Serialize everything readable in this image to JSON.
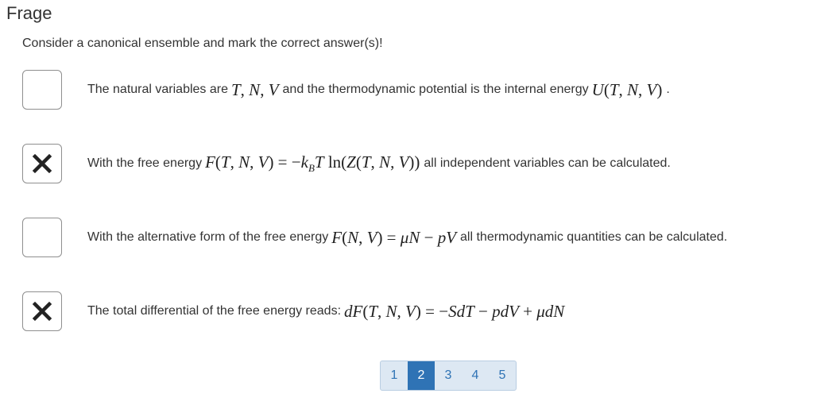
{
  "title": "Frage",
  "prompt": "Consider a canonical ensemble and mark the correct answer(s)!",
  "options": [
    {
      "checked": false,
      "text_before": "The natural variables are",
      "math_1": "T, N, V",
      "text_middle": "and the thermodynamic potential is the internal energy",
      "math_2": "U(T, N, V)",
      "text_after": "."
    },
    {
      "checked": true,
      "text_before": "With the free energy",
      "math_1": "F(T, N, V) = −k_B T ln(Z(T, N, V))",
      "text_after": "all independent variables can be calculated."
    },
    {
      "checked": false,
      "text_before": "With the alternative form of the free energy",
      "math_1": "F(N, V) = μN − pV",
      "text_after": "all thermodynamic quantities can be calculated."
    },
    {
      "checked": true,
      "text_before": "The total differential of the free energy reads:",
      "math_1": "dF(T, N, V) = −SdT − pdV + μdN"
    }
  ],
  "pagination": {
    "pages": [
      "1",
      "2",
      "3",
      "4",
      "5"
    ],
    "current": "2"
  },
  "icons": {
    "checked": "close-x-icon"
  },
  "colors": {
    "accent": "#2f73b5",
    "pager_bg": "#dde8f3"
  }
}
